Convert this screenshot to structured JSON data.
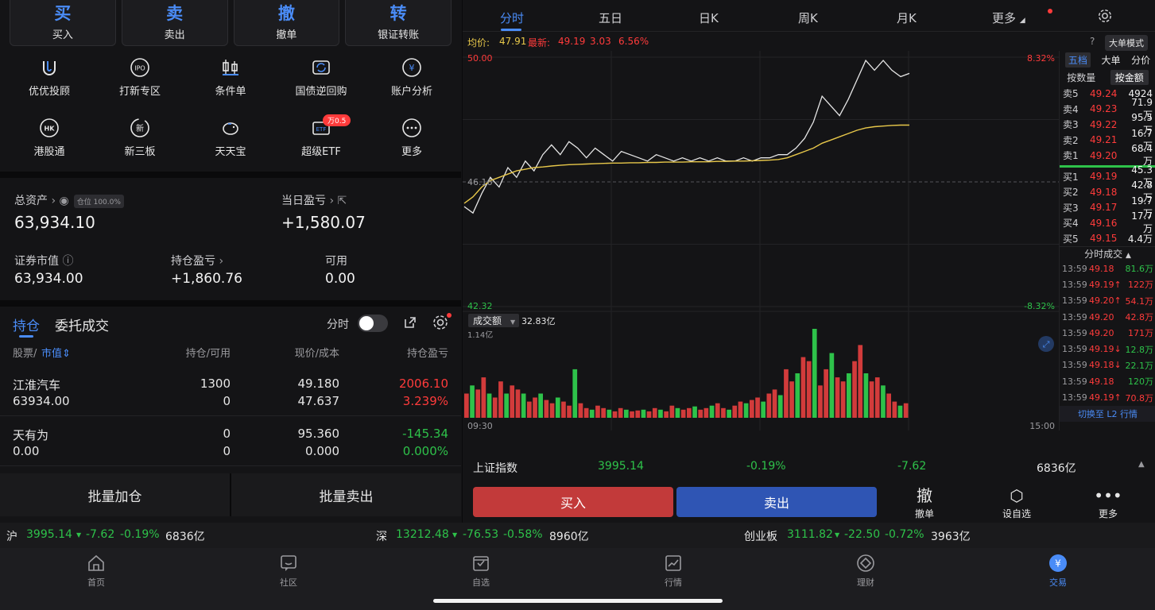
{
  "trade_buttons": [
    {
      "big": "买",
      "small": "买入"
    },
    {
      "big": "卖",
      "small": "卖出"
    },
    {
      "big": "撤",
      "small": "撤单"
    },
    {
      "big": "转",
      "small": "银证转账"
    }
  ],
  "grid": [
    {
      "label": "优优投顾",
      "icon": "uu-advisor-icon"
    },
    {
      "label": "打新专区",
      "icon": "ipo-icon",
      "glyph": "IPO"
    },
    {
      "label": "条件单",
      "icon": "condition-order-icon"
    },
    {
      "label": "国债逆回购",
      "icon": "bond-repo-icon"
    },
    {
      "label": "账户分析",
      "icon": "account-analysis-icon",
      "glyph": "¥"
    },
    {
      "label": "港股通",
      "icon": "hk-connect-icon",
      "glyph": "HK"
    },
    {
      "label": "新三板",
      "icon": "neeq-icon",
      "glyph": "新"
    },
    {
      "label": "天天宝",
      "icon": "piggy-bank-icon"
    },
    {
      "label": "超级ETF",
      "icon": "etf-icon",
      "glyph": "ETF",
      "badge": "万0.5"
    },
    {
      "label": "更多",
      "icon": "more-icon"
    }
  ],
  "assets": {
    "total_label": "总资产",
    "position_pill": "仓位 100.0%",
    "total_value": "63,934.10",
    "day_pl_label": "当日盈亏",
    "day_pl_value": "+1,580.07",
    "mkt_label": "证券市值",
    "mkt_value": "63,934.00",
    "hold_pl_label": "持仓盈亏",
    "hold_pl_value": "+1,860.76",
    "avail_label": "可用",
    "avail_value": "0.00"
  },
  "position_tabs": {
    "tab1": "持仓",
    "tab2": "委托成交",
    "toggle_label": "分时"
  },
  "table": {
    "headers": [
      "股票/",
      "市值",
      "持仓/可用",
      "现价/成本",
      "持仓盈亏"
    ],
    "rows": [
      {
        "name": "江淮汽车",
        "mv": "63934.00",
        "hold": "1300",
        "avail": "0",
        "price": "49.180",
        "cost": "47.637",
        "pl": "2006.10",
        "plpct": "3.239%",
        "color": "red"
      },
      {
        "name": "天有为",
        "mv": "0.00",
        "hold": "0",
        "avail": "0",
        "price": "95.360",
        "cost": "0.000",
        "pl": "-145.34",
        "plpct": "0.000%",
        "color": "green"
      }
    ],
    "batch_add": "批量加仓",
    "batch_sell": "批量卖出"
  },
  "chart_tabs": [
    "分时",
    "五日",
    "日K",
    "周K",
    "月K",
    "更多"
  ],
  "pricebar": {
    "avg_label": "均价:",
    "avg_value": "47.91",
    "last_label": "最新:",
    "last_value": "49.19",
    "change": "3.03",
    "change_pct": "6.56%",
    "mode_button": "大单模式"
  },
  "chart_data": {
    "type": "line",
    "ylim": [
      42.32,
      50.0
    ],
    "y_labels": {
      "top": "50.00",
      "mid": "46.16",
      "bottom": "42.32",
      "top_pct": "8.32%",
      "bottom_pct": "-8.32%"
    },
    "prev_close": 46.16,
    "x_labels": {
      "start": "09:30",
      "end": "15:00"
    },
    "series": [
      {
        "values": [
          45.4,
          45.2,
          45.8,
          46.3,
          46.0,
          46.6,
          46.3,
          46.8,
          46.5,
          47.0,
          47.3,
          47.0,
          47.4,
          47.2,
          46.9,
          47.2,
          47.0,
          46.8,
          47.1,
          47.0,
          46.9,
          46.8,
          47.0,
          46.9,
          46.8,
          46.9,
          46.8,
          46.9,
          46.8,
          46.9,
          46.8,
          46.8,
          46.9,
          46.8,
          46.9,
          46.9,
          47.0,
          47.0,
          47.2,
          47.5,
          48.0,
          48.8,
          48.5,
          48.2,
          48.7,
          49.3,
          49.9,
          49.6,
          49.9,
          49.6,
          49.4,
          49.5
        ]
      },
      {
        "values": [
          45.5,
          45.7,
          46.0,
          46.2,
          46.3,
          46.4,
          46.5,
          46.55,
          46.6,
          46.62,
          46.65,
          46.67,
          46.69,
          46.7,
          46.71,
          46.72,
          46.73,
          46.74,
          46.74,
          46.75,
          46.75,
          46.76,
          46.76,
          46.77,
          46.77,
          46.77,
          46.78,
          46.78,
          46.78,
          46.79,
          46.79,
          46.8,
          46.8,
          46.81,
          46.82,
          46.83,
          46.85,
          46.9,
          47.0,
          47.1,
          47.2,
          47.35,
          47.45,
          47.55,
          47.65,
          47.75,
          47.82,
          47.86,
          47.88,
          47.9,
          47.91,
          47.91
        ]
      }
    ],
    "volume_label": "成交额",
    "volume_value": "32.83亿",
    "volume_max_label": "1.14亿",
    "volume": [
      30,
      40,
      35,
      50,
      30,
      25,
      45,
      30,
      40,
      35,
      30,
      20,
      25,
      30,
      22,
      18,
      25,
      20,
      15,
      60,
      18,
      12,
      10,
      15,
      12,
      10,
      8,
      12,
      10,
      8,
      9,
      10,
      8,
      12,
      10,
      8,
      15,
      12,
      10,
      12,
      14,
      10,
      12,
      15,
      18,
      12,
      10,
      15,
      20,
      18,
      22,
      25,
      20,
      30,
      35,
      28,
      60,
      45,
      55,
      75,
      70,
      110,
      40,
      60,
      80,
      50,
      45,
      55,
      70,
      90,
      55,
      45,
      50,
      40,
      30,
      20,
      15,
      18
    ]
  },
  "orderbook": {
    "tabs": [
      "五档",
      "大单",
      "分价"
    ],
    "sub": [
      "按数量",
      "按金额"
    ],
    "sells": [
      {
        "l": "卖5",
        "p": "49.24",
        "v": "4924"
      },
      {
        "l": "卖4",
        "p": "49.23",
        "v": "71.9万"
      },
      {
        "l": "卖3",
        "p": "49.22",
        "v": "95.5万"
      },
      {
        "l": "卖2",
        "p": "49.21",
        "v": "16.7万"
      },
      {
        "l": "卖1",
        "p": "49.20",
        "v": "68.4万"
      }
    ],
    "buys": [
      {
        "l": "买1",
        "p": "49.19",
        "v": "45.3万"
      },
      {
        "l": "买2",
        "p": "49.18",
        "v": "42.8万"
      },
      {
        "l": "买3",
        "p": "49.17",
        "v": "19.7万"
      },
      {
        "l": "买4",
        "p": "49.16",
        "v": "17.7万"
      },
      {
        "l": "买5",
        "p": "49.15",
        "v": "4.4万"
      }
    ],
    "trades_title": "分时成交",
    "trades": [
      {
        "t": "13:59",
        "p": "49.18",
        "v": "81.6万",
        "c": "green"
      },
      {
        "t": "13:59",
        "p": "49.19↑",
        "v": "122万",
        "c": "red"
      },
      {
        "t": "13:59",
        "p": "49.20↑",
        "v": "54.1万",
        "c": "red"
      },
      {
        "t": "13:59",
        "p": "49.20",
        "v": "42.8万",
        "c": "red"
      },
      {
        "t": "13:59",
        "p": "49.20",
        "v": "171万",
        "c": "red"
      },
      {
        "t": "13:59",
        "p": "49.19↓",
        "v": "12.8万",
        "c": "green"
      },
      {
        "t": "13:59",
        "p": "49.18↓",
        "v": "22.1万",
        "c": "green"
      },
      {
        "t": "13:59",
        "p": "49.18",
        "v": "120万",
        "c": "green"
      },
      {
        "t": "13:59",
        "p": "49.19↑",
        "v": "70.8万",
        "c": "red"
      }
    ],
    "l2": "切换至 L2 行情"
  },
  "index_bar": {
    "name": "上证指数",
    "value": "3995.14",
    "pct": "-0.19%",
    "change": "-7.62",
    "amount": "6836亿"
  },
  "action_bar": {
    "buy": "买入",
    "sell": "卖出",
    "cancel_glyph": "撤",
    "cancel": "撤单",
    "watch": "设自选",
    "more": "更多"
  },
  "ticker": {
    "sh_label": "沪",
    "sh_value": "3995.14",
    "sh_change": "-7.62",
    "sh_pct": "-0.19%",
    "sh_amount": "6836亿",
    "sz_label": "深",
    "sz_value": "13212.48",
    "sz_change": "-76.53",
    "sz_pct": "-0.58%",
    "sz_amount": "8960亿",
    "cy_label": "创业板",
    "cy_value": "3111.82",
    "cy_change": "-22.50",
    "cy_pct": "-0.72%",
    "cy_amount": "3963亿"
  },
  "nav": [
    {
      "label": "首页",
      "icon": "home-icon"
    },
    {
      "label": "社区",
      "icon": "community-icon"
    },
    {
      "label": "自选",
      "icon": "watchlist-icon"
    },
    {
      "label": "行情",
      "icon": "market-icon"
    },
    {
      "label": "理财",
      "icon": "wealth-icon"
    },
    {
      "label": "交易",
      "icon": "trade-icon",
      "active": true
    }
  ],
  "colors": {
    "accent": "#4a8cf7",
    "up": "#ff3b3b",
    "down": "#2ec24a",
    "avg": "#e8c84a"
  }
}
